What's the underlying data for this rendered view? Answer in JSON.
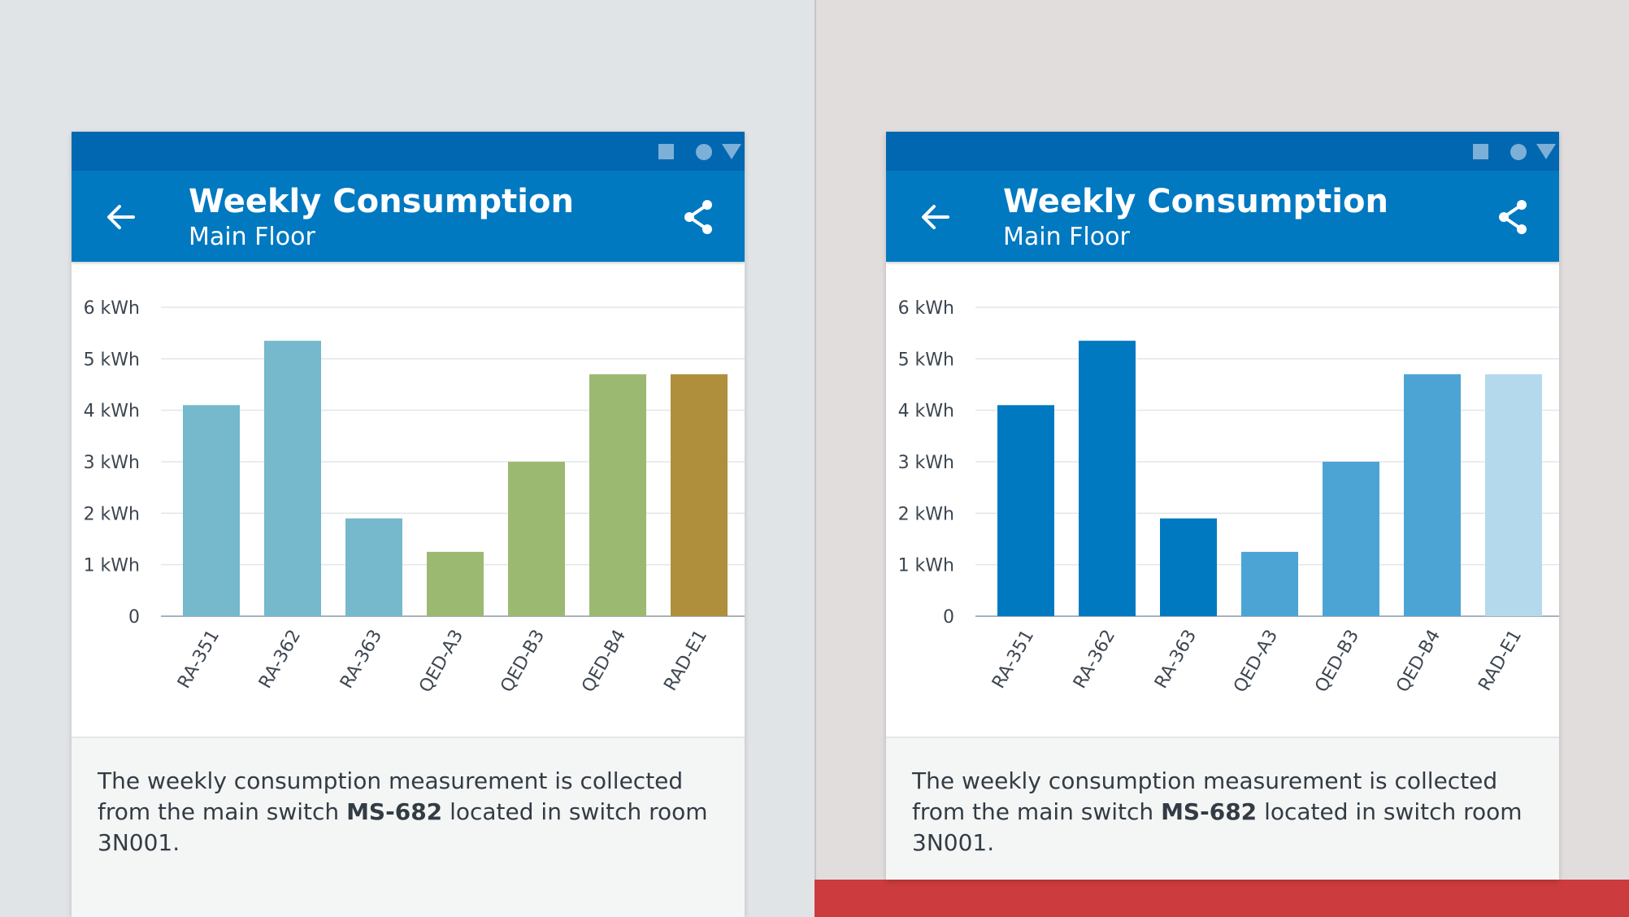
{
  "screens": [
    {
      "header": {
        "title": "Weekly Consumption",
        "subtitle": "Main Floor"
      },
      "footer": {
        "text_before": "The weekly consumption measurement is collected from the main switch ",
        "highlight": "MS-682",
        "text_after": " located in switch room 3N001."
      },
      "chart_data": {
        "type": "bar",
        "categories": [
          "RA-351",
          "RA-362",
          "RA-363",
          "QED-A3",
          "QED-B3",
          "QED-B4",
          "RAD-E1"
        ],
        "values": [
          4.1,
          5.35,
          1.9,
          1.25,
          3.0,
          4.7,
          4.7
        ],
        "colors": [
          "#76b8cc",
          "#76b8cc",
          "#76b8cc",
          "#9cb971",
          "#9cb971",
          "#9cb971",
          "#af8e3c"
        ],
        "y_ticks": [
          "0",
          "1 kWh",
          "2 kWh",
          "3 kWh",
          "4 kWh",
          "5 kWh",
          "6 kWh"
        ],
        "ylim": [
          0,
          6
        ],
        "grid": true
      }
    },
    {
      "header": {
        "title": "Weekly Consumption",
        "subtitle": "Main Floor"
      },
      "footer": {
        "text_before": "The weekly consumption measurement is collected from the main switch ",
        "highlight": "MS-682",
        "text_after": " located in switch room 3N001."
      },
      "chart_data": {
        "type": "bar",
        "categories": [
          "RA-351",
          "RA-362",
          "RA-363",
          "QED-A3",
          "QED-B3",
          "QED-B4",
          "RAD-E1"
        ],
        "values": [
          4.1,
          5.35,
          1.9,
          1.25,
          3.0,
          4.7,
          4.7
        ],
        "colors": [
          "#0079c1",
          "#0079c1",
          "#0079c1",
          "#4ca4d5",
          "#4ca4d5",
          "#4ca4d5",
          "#b5d9ec"
        ],
        "y_ticks": [
          "0",
          "1 kWh",
          "2 kWh",
          "3 kWh",
          "4 kWh",
          "5 kWh",
          "6 kWh"
        ],
        "ylim": [
          0,
          6
        ],
        "grid": true
      }
    }
  ],
  "colors": {
    "statusbar": "#0067b0",
    "appbar": "#0079c1",
    "status_icons": "#7cb0d8",
    "bottom_accent": "#cc3b3d"
  },
  "icons": [
    "back-arrow-icon",
    "share-icon",
    "square-icon",
    "circle-icon",
    "triangle-icon"
  ]
}
